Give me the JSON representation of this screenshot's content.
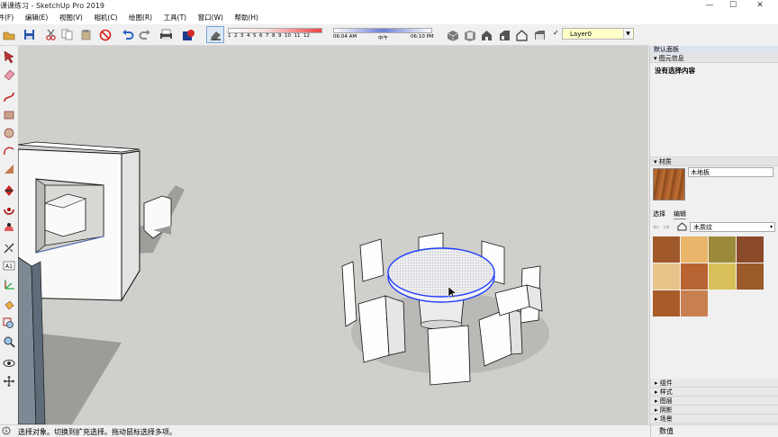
{
  "window": {
    "title": "课课练习 - SketchUp Pro 2019",
    "minimize": "—",
    "maximize": "☐",
    "close": "✕"
  },
  "menu": [
    "文件(F)",
    "编辑(E)",
    "视图(V)",
    "相机(C)",
    "绘图(R)",
    "工具(T)",
    "窗口(W)",
    "帮助(H)"
  ],
  "shadow": {
    "months": [
      "1",
      "2",
      "3",
      "4",
      "5",
      "6",
      "7",
      "8",
      "9",
      "10",
      "11",
      "12"
    ],
    "time_start": "06:04 AM",
    "time_mid": "中午",
    "time_end": "06:10 PM"
  },
  "layer": {
    "value": "Layer0"
  },
  "panel": {
    "tray_title": "默认面板",
    "entity_info_header": "图元信息",
    "entity_info_text": "没有选择内容",
    "materials_header": "材质",
    "material_name": "木地板",
    "tab_select": "选择",
    "tab_edit": "编辑",
    "library": "木质纹",
    "sections": [
      "组件",
      "样式",
      "图层",
      "阴影",
      "场景"
    ]
  },
  "status": {
    "text": "选择对象。切换到扩充选择。拖动鼠标选择多项。",
    "measure_label": "数值"
  },
  "colors": {
    "viewport": "#cfcfcb",
    "selection_blue": "#1e3cff",
    "wood_swatches": [
      "#a0582a",
      "#e8b56a",
      "#9b8a3a",
      "#8a4a2a",
      "#b86432",
      "#e6c48a",
      "#8a4a1e",
      "#d9c05a",
      "#9a5a2a",
      "#b05a3a",
      "#a85a28",
      "#c98050"
    ]
  }
}
